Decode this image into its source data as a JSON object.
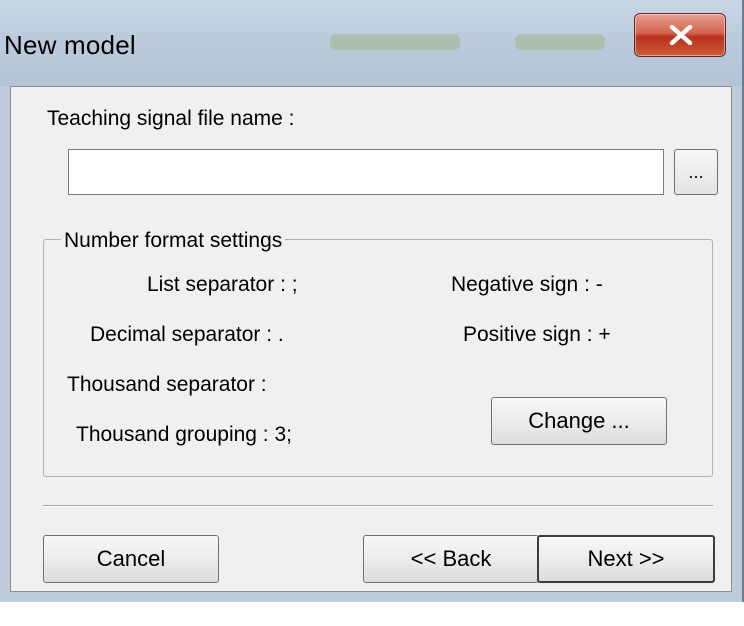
{
  "window": {
    "title": "New model",
    "close_icon": "close-icon"
  },
  "file": {
    "label": "Teaching signal file name :",
    "value": "",
    "placeholder": "",
    "browse_label": "..."
  },
  "number_format": {
    "group_title": "Number format settings",
    "list_separator": "List separator :  ;",
    "negative_sign": "Negative sign :  -",
    "decimal_separator": "Decimal separator :  .",
    "positive_sign": "Positive sign :  +",
    "thousand_separator": "Thousand separator :",
    "thousand_grouping": "Thousand grouping :  3;",
    "change_label": "Change ..."
  },
  "footer": {
    "cancel_label": "Cancel",
    "back_label": "<< Back",
    "next_label": "Next >>"
  },
  "colors": {
    "title_bar": "#bccbdc",
    "close_button": "#c8442a",
    "dialog_background": "#f0f0f0"
  }
}
